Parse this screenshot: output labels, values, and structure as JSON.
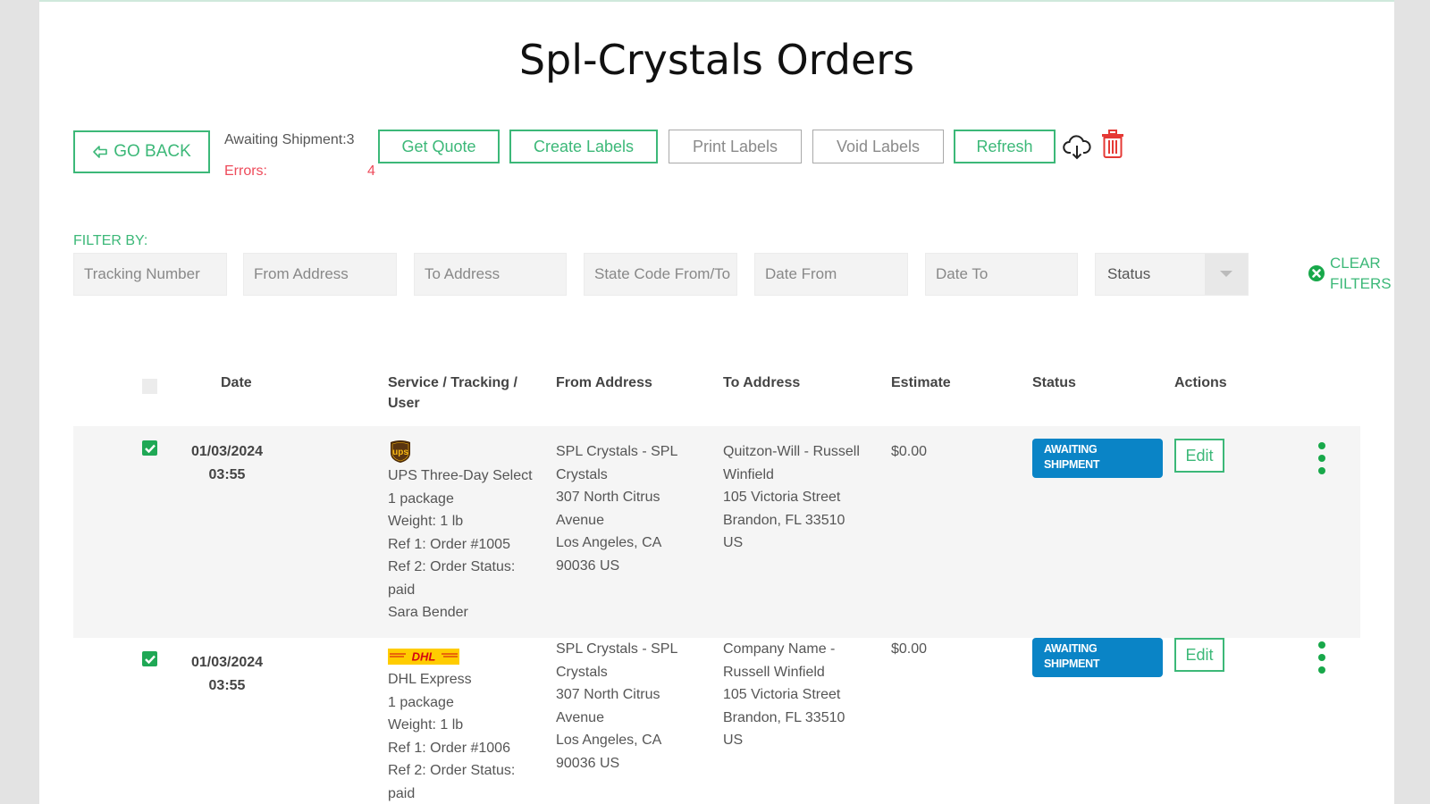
{
  "page": {
    "title": "Spl-Crystals Orders"
  },
  "toolbar": {
    "go_back": "GO BACK",
    "awaiting_label": "Awaiting Shipment:3",
    "errors_label": "Errors:",
    "errors_count": "4",
    "get_quote": "Get Quote",
    "create_labels": "Create Labels",
    "print_labels": "Print Labels",
    "void_labels": "Void Labels",
    "refresh": "Refresh",
    "icons": [
      "cloud-download-icon",
      "trash-icon"
    ]
  },
  "filters": {
    "label": "FILTER BY:",
    "tracking_placeholder": "Tracking Number",
    "from_placeholder": "From Address",
    "to_placeholder": "To Address",
    "state_placeholder": "State Code From/To",
    "date_from_placeholder": "Date From",
    "date_to_placeholder": "Date To",
    "status_selected": "Status",
    "clear_line1": "CLEAR",
    "clear_line2": "FILTERS"
  },
  "table": {
    "headers": {
      "date": "Date",
      "service_line1": "Service / Tracking /",
      "service_line2": "User",
      "from": "From Address",
      "to": "To Address",
      "estimate": "Estimate",
      "status": "Status",
      "actions": "Actions"
    },
    "rows": [
      {
        "checked": true,
        "date": "01/03/2024",
        "time": "03:55",
        "carrier": "UPS",
        "service": "UPS Three-Day Select",
        "packages": "1 package",
        "weight": "Weight: 1 lb",
        "ref1": "Ref 1: Order #1005",
        "ref2": "Ref 2: Order Status:",
        "ref2_value": "paid",
        "user": "Sara Bender",
        "from": [
          "SPL Crystals - SPL",
          "Crystals",
          "307 North Citrus",
          "Avenue",
          "Los Angeles, CA",
          "90036 US"
        ],
        "to": [
          "Quitzon-Will - Russell",
          "Winfield",
          "105 Victoria Street",
          "Brandon, FL 33510",
          "US"
        ],
        "estimate": "$0.00",
        "status_line1": "AWAITING",
        "status_line2": "SHIPMENT",
        "edit": "Edit"
      },
      {
        "checked": true,
        "date": "01/03/2024",
        "time": "03:55",
        "carrier": "DHL",
        "service": "DHL Express",
        "packages": "1 package",
        "weight": "Weight: 1 lb",
        "ref1": "Ref 1: Order #1006",
        "ref2": "Ref 2: Order Status:",
        "ref2_value": "paid",
        "from": [
          "SPL Crystals - SPL",
          "Crystals",
          "307 North Citrus",
          "Avenue",
          "Los Angeles, CA",
          "90036 US"
        ],
        "to": [
          "Company Name -",
          "Russell Winfield",
          "105 Victoria Street",
          "Brandon, FL 33510",
          "US"
        ],
        "estimate": "$0.00",
        "status_line1": "AWAITING",
        "status_line2": "SHIPMENT",
        "edit": "Edit"
      }
    ]
  },
  "colors": {
    "accent": "#3cb878",
    "error": "#ee4b5b",
    "badge": "#0a84c6",
    "trash": "#e53935"
  }
}
